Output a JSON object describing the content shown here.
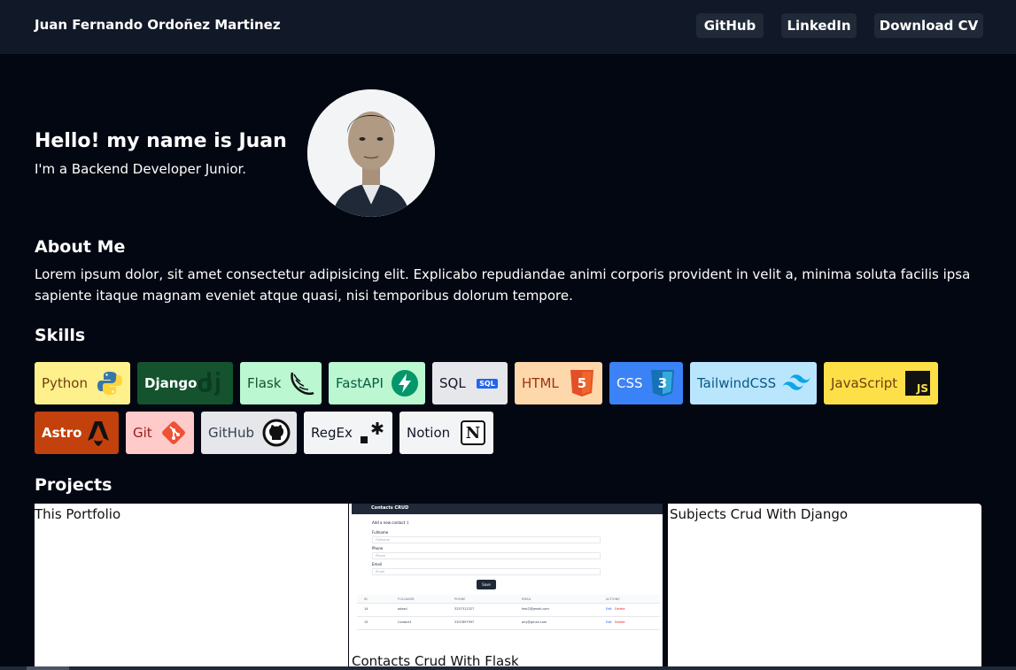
{
  "navbar": {
    "brand": "Juan Fernando Ordoñez Martinez",
    "links": [
      "GitHub",
      "LinkedIn",
      "Download CV"
    ]
  },
  "hero": {
    "title": "Hello! my name is Juan",
    "subtitle": "I'm a Backend Developer Junior."
  },
  "about": {
    "heading": "About Me",
    "text": "Lorem ipsum dolor, sit amet consectetur adipisicing elit. Explicabo repudiandae animi corporis provident in velit a, minima soluta facilis ipsa sapiente itaque magnam eveniet atque quasi, nisi temporibus dolorum tempore."
  },
  "skills": {
    "heading": "Skills",
    "items": [
      {
        "label": "Python",
        "icon": "python-icon",
        "bg": "#fef08a",
        "color": "#713f12"
      },
      {
        "label": "Django",
        "icon": "django-icon",
        "bg": "#14532d",
        "color": "#ffffff"
      },
      {
        "label": "Flask",
        "icon": "flask-icon",
        "bg": "#bbf7d0",
        "color": "#14532d"
      },
      {
        "label": "FastAPI",
        "icon": "fastapi-icon",
        "bg": "#bbf7d0",
        "color": "#065f46"
      },
      {
        "label": "SQL",
        "icon": "sql-icon",
        "icon_text": "SQL",
        "bg": "#e5e7eb",
        "color": "#111827"
      },
      {
        "label": "HTML",
        "icon": "html5-icon",
        "icon_text": "5",
        "bg": "#fed7aa",
        "color": "#9a3412"
      },
      {
        "label": "CSS",
        "icon": "css3-icon",
        "icon_text": "3",
        "bg": "#3b82f6",
        "color": "#ffffff"
      },
      {
        "label": "TailwindCSS",
        "icon": "tailwind-icon",
        "bg": "#bae6fd",
        "color": "#075985"
      },
      {
        "label": "JavaScript",
        "icon": "javascript-icon",
        "icon_text": "JS",
        "bg": "#fde047",
        "color": "#713f12"
      },
      {
        "label": "Astro",
        "icon": "astro-icon",
        "bg": "#c2410c",
        "color": "#ffffff"
      },
      {
        "label": "Git",
        "icon": "git-icon",
        "bg": "#fecaca",
        "color": "#991b1b"
      },
      {
        "label": "GitHub",
        "icon": "github-icon",
        "bg": "#e5e7eb",
        "color": "#374151"
      },
      {
        "label": "RegEx",
        "icon": "regex-icon",
        "bg": "#f3f4f6",
        "color": "#111827"
      },
      {
        "label": "Notion",
        "icon": "notion-icon",
        "icon_text": "N",
        "bg": "#f3f4f6",
        "color": "#111827"
      }
    ]
  },
  "projects": {
    "heading": "Projects",
    "items": [
      {
        "title": "This Portfolio"
      },
      {
        "title": "Contacts Crud With Flask"
      },
      {
        "title": "Subjects Crud With Django"
      }
    ]
  },
  "contacts_preview": {
    "app_title": "Contacts CRUD",
    "form_heading": "Add a new contact :)",
    "fields": [
      {
        "label": "Fullname",
        "placeholder": "Fullname"
      },
      {
        "label": "Phone",
        "placeholder": "Phone"
      },
      {
        "label": "Email",
        "placeholder": "Email"
      }
    ],
    "save": "Save",
    "columns": [
      "ID",
      "FULLNAME",
      "PHONE",
      "EMAIL",
      "ACTIONS"
    ],
    "rows": [
      {
        "id": "14",
        "fullname": "adasd",
        "phone": "3257312327",
        "email": "test2@gmail.com",
        "edit": "Edit",
        "delete": "Delete"
      },
      {
        "id": "15",
        "fullname": "Contact1",
        "phone": "3307897997",
        "email": "any@gmail.com",
        "edit": "Edit",
        "delete": "Delete"
      }
    ]
  }
}
